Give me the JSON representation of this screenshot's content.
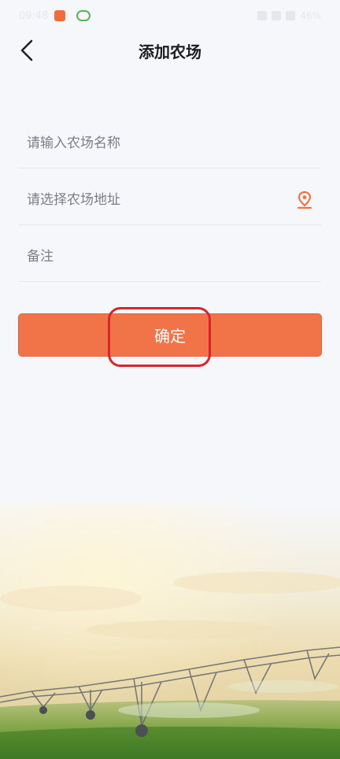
{
  "status_bar": {
    "time": "09:48",
    "right_text": "46%"
  },
  "header": {
    "title": "添加农场",
    "back_icon": "chevron-left-icon"
  },
  "form": {
    "farm_name_placeholder": "请输入农场名称",
    "farm_address_placeholder": "请选择农场地址",
    "remark_placeholder": "备注",
    "location_icon": "map-pin-icon"
  },
  "confirm": {
    "label": "确定"
  },
  "colors": {
    "accent": "#f07447",
    "highlight": "#d9242b",
    "background": "#f6f7fb"
  }
}
